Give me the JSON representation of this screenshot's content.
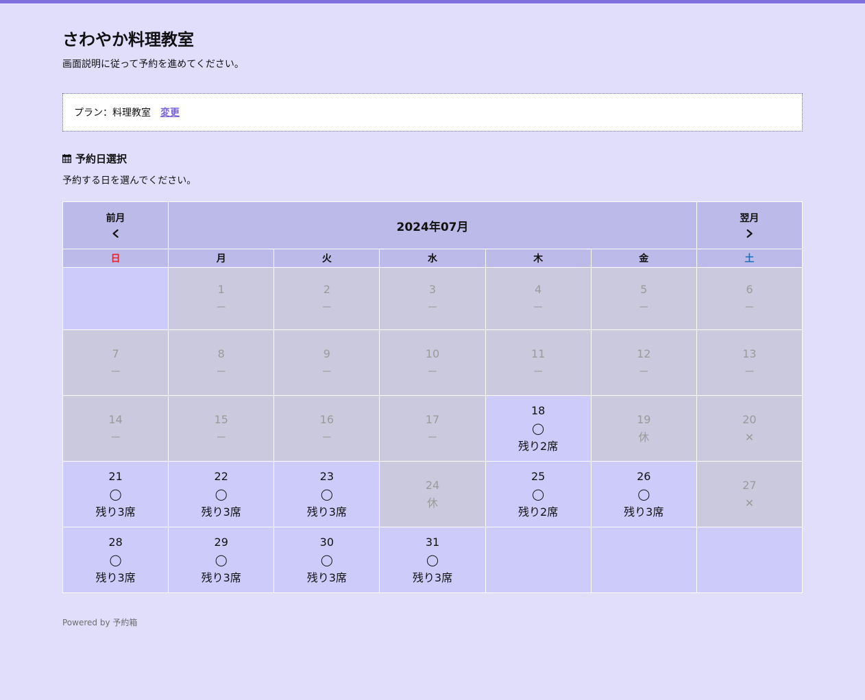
{
  "header": {
    "title": "さわやか料理教室",
    "subtitle": "画面説明に従って予約を進めてください。"
  },
  "plan": {
    "text": "プラン：料理教室",
    "change_label": "変更"
  },
  "section": {
    "heading": "予約日選択",
    "description": "予約する日を選んでください。"
  },
  "calendar": {
    "prev_label": "前月",
    "next_label": "翌月",
    "month": "2024年07月",
    "weekdays": [
      "日",
      "月",
      "火",
      "水",
      "木",
      "金",
      "土"
    ],
    "weeks": [
      [
        {
          "day": "",
          "status": "",
          "note": "",
          "state": "empty"
        },
        {
          "day": "1",
          "status": "－",
          "note": "",
          "state": "disabled"
        },
        {
          "day": "2",
          "status": "－",
          "note": "",
          "state": "disabled"
        },
        {
          "day": "3",
          "status": "－",
          "note": "",
          "state": "disabled"
        },
        {
          "day": "4",
          "status": "－",
          "note": "",
          "state": "disabled"
        },
        {
          "day": "5",
          "status": "－",
          "note": "",
          "state": "disabled"
        },
        {
          "day": "6",
          "status": "－",
          "note": "",
          "state": "disabled"
        }
      ],
      [
        {
          "day": "7",
          "status": "－",
          "note": "",
          "state": "disabled"
        },
        {
          "day": "8",
          "status": "－",
          "note": "",
          "state": "disabled"
        },
        {
          "day": "9",
          "status": "－",
          "note": "",
          "state": "disabled"
        },
        {
          "day": "10",
          "status": "－",
          "note": "",
          "state": "disabled"
        },
        {
          "day": "11",
          "status": "－",
          "note": "",
          "state": "disabled"
        },
        {
          "day": "12",
          "status": "－",
          "note": "",
          "state": "disabled"
        },
        {
          "day": "13",
          "status": "－",
          "note": "",
          "state": "disabled"
        }
      ],
      [
        {
          "day": "14",
          "status": "－",
          "note": "",
          "state": "disabled"
        },
        {
          "day": "15",
          "status": "－",
          "note": "",
          "state": "disabled"
        },
        {
          "day": "16",
          "status": "－",
          "note": "",
          "state": "disabled"
        },
        {
          "day": "17",
          "status": "－",
          "note": "",
          "state": "disabled"
        },
        {
          "day": "18",
          "status": "◯",
          "note": "残り2席",
          "state": "available"
        },
        {
          "day": "19",
          "status": "休",
          "note": "",
          "state": "disabled"
        },
        {
          "day": "20",
          "status": "✕",
          "note": "",
          "state": "disabled"
        }
      ],
      [
        {
          "day": "21",
          "status": "◯",
          "note": "残り3席",
          "state": "available"
        },
        {
          "day": "22",
          "status": "◯",
          "note": "残り3席",
          "state": "available"
        },
        {
          "day": "23",
          "status": "◯",
          "note": "残り3席",
          "state": "available"
        },
        {
          "day": "24",
          "status": "休",
          "note": "",
          "state": "disabled"
        },
        {
          "day": "25",
          "status": "◯",
          "note": "残り2席",
          "state": "available"
        },
        {
          "day": "26",
          "status": "◯",
          "note": "残り3席",
          "state": "available"
        },
        {
          "day": "27",
          "status": "✕",
          "note": "",
          "state": "disabled"
        }
      ],
      [
        {
          "day": "28",
          "status": "◯",
          "note": "残り3席",
          "state": "available"
        },
        {
          "day": "29",
          "status": "◯",
          "note": "残り3席",
          "state": "available"
        },
        {
          "day": "30",
          "status": "◯",
          "note": "残り3席",
          "state": "available"
        },
        {
          "day": "31",
          "status": "◯",
          "note": "残り3席",
          "state": "available"
        },
        {
          "day": "",
          "status": "",
          "note": "",
          "state": "empty"
        },
        {
          "day": "",
          "status": "",
          "note": "",
          "state": "empty"
        },
        {
          "day": "",
          "status": "",
          "note": "",
          "state": "empty"
        }
      ]
    ]
  },
  "footer": {
    "text": "Powered by 予約箱"
  },
  "colors": {
    "page_background": "#e1defc",
    "accent": "#7f6fdc",
    "header_cell": "#bcbae8",
    "available_cell": "#cdcbfa",
    "disabled_cell": "#cbc9de",
    "sunday": "#e0252c",
    "saturday": "#1d6fc0"
  }
}
